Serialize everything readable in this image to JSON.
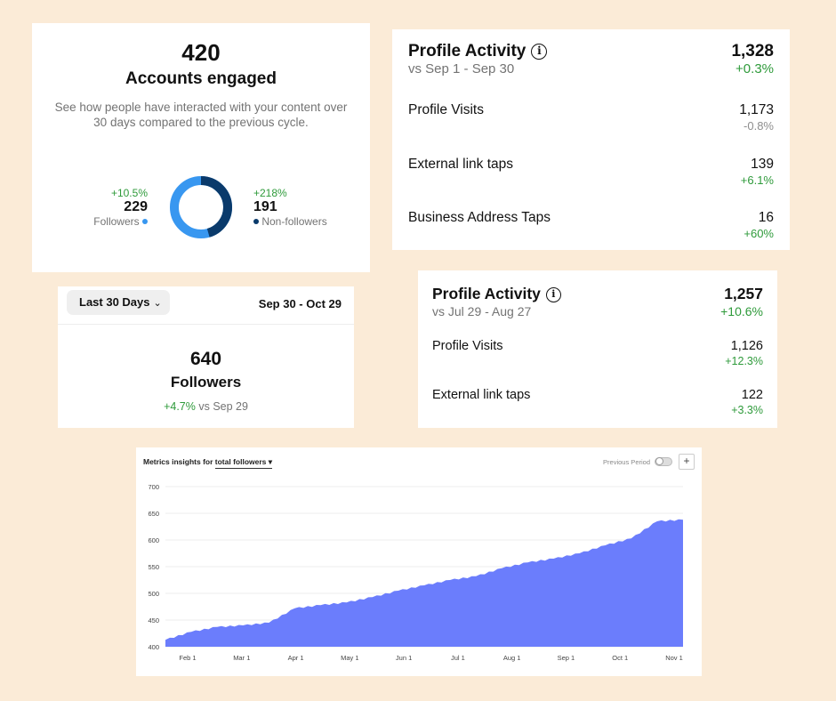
{
  "engaged": {
    "count": "420",
    "title": "Accounts engaged",
    "description": "See how people have interacted with your content over 30 days compared to the previous cycle.",
    "followers": {
      "change": "+10.5%",
      "count": "229",
      "label": "Followers",
      "color": "#3897f0"
    },
    "non_followers": {
      "change": "+218%",
      "count": "191",
      "label": "Non-followers",
      "color": "#0a3a6b"
    }
  },
  "profile_activity_1": {
    "title": "Profile Activity",
    "compare": "vs Sep 1 - Sep 30",
    "total": "1,328",
    "total_change": "+0.3%",
    "rows": [
      {
        "label": "Profile Visits",
        "value": "1,173",
        "change": "-0.8%"
      },
      {
        "label": "External link taps",
        "value": "139",
        "change": "+6.1%"
      },
      {
        "label": "Business Address Taps",
        "value": "16",
        "change": "+60%"
      }
    ]
  },
  "profile_activity_2": {
    "title": "Profile Activity",
    "compare": "vs Jul 29 - Aug 27",
    "total": "1,257",
    "total_change": "+10.6%",
    "rows": [
      {
        "label": "Profile Visits",
        "value": "1,126",
        "change": "+12.3%"
      },
      {
        "label": "External link taps",
        "value": "122",
        "change": "+3.3%"
      }
    ]
  },
  "followers_card": {
    "range_button": "Last 30 Days",
    "date_range": "Sep 30 - Oct 29",
    "count": "640",
    "label": "Followers",
    "change": "+4.7%",
    "compare": "vs Sep 29"
  },
  "metrics": {
    "prefix": "Metrics insights for",
    "metric": "total followers",
    "previous_period": "Previous Period",
    "add": "+"
  },
  "colors": {
    "green": "#2e9a3a",
    "area": "#6b7dfc",
    "background": "#fbebd7"
  },
  "chart_data": {
    "type": "area",
    "x": [
      "Jan 25",
      "Feb 1",
      "Feb 15",
      "Mar 1",
      "Mar 15",
      "Apr 1",
      "Apr 15",
      "May 1",
      "May 15",
      "Jun 1",
      "Jun 15",
      "Jul 1",
      "Jul 15",
      "Aug 1",
      "Aug 15",
      "Sep 1",
      "Sep 15",
      "Oct 1",
      "Oct 15",
      "Nov 1",
      "Nov 5"
    ],
    "series": [
      {
        "values": [
          413,
          428,
          437,
          440,
          445,
          472,
          478,
          483,
          493,
          505,
          515,
          525,
          532,
          547,
          558,
          565,
          575,
          590,
          603,
          635,
          638
        ]
      }
    ],
    "x_ticks": [
      "Feb 1",
      "Mar 1",
      "Apr 1",
      "May 1",
      "Jun 1",
      "Jul 1",
      "Aug 1",
      "Sep 1",
      "Oct 1",
      "Nov 1"
    ],
    "y_ticks": [
      400,
      450,
      500,
      550,
      600,
      650,
      700
    ],
    "ylim": [
      400,
      700
    ],
    "grid": true
  }
}
